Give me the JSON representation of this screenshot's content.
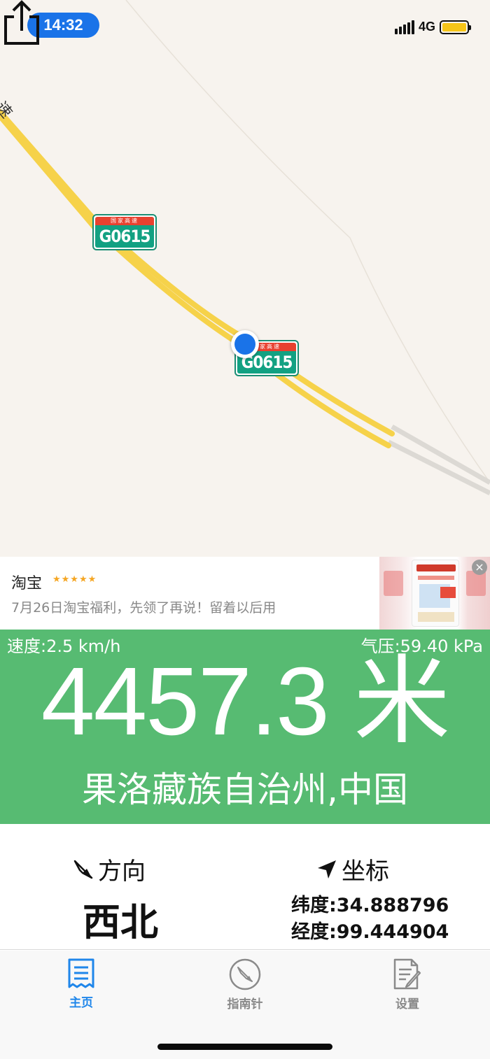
{
  "status_bar": {
    "time": "14:32",
    "network": "4G"
  },
  "map": {
    "road_label_partial": "速",
    "shields": [
      {
        "top_text": "国家高速",
        "code": "G0615"
      },
      {
        "top_text": "国家高速",
        "code": "G0615"
      }
    ],
    "share_icon": "share-icon"
  },
  "ad": {
    "title": "淘宝",
    "stars": "★★★★★",
    "description": "7月26日淘宝福利，先领了再说！留着以后用",
    "close_symbol": "×"
  },
  "altitude_panel": {
    "speed": "速度:2.5 km/h",
    "pressure": "气压:59.40 kPa",
    "altitude": "4457.3 米",
    "place": "果洛藏族自治州,中国",
    "background_color": "#57bb72"
  },
  "direction": {
    "label": "方向",
    "value": "西北",
    "icon": "compass-needle-icon"
  },
  "coordinates": {
    "label": "坐标",
    "icon": "location-arrow-icon",
    "latitude": "纬度:34.888796",
    "longitude": "经度:99.444904"
  },
  "tabbar": {
    "tabs": [
      {
        "label": "主页",
        "icon": "receipt-icon",
        "active": true
      },
      {
        "label": "指南针",
        "icon": "compass-icon",
        "active": false
      },
      {
        "label": "设置",
        "icon": "document-edit-icon",
        "active": false
      }
    ],
    "active_color": "#1f86ea"
  }
}
